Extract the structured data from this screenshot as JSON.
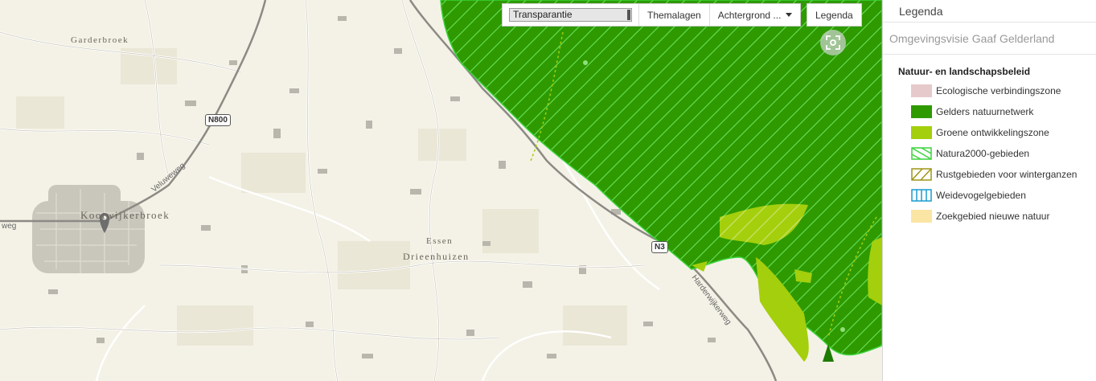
{
  "toolbar": {
    "transparency_label": "Transparantie",
    "themalagen_label": "Themalagen",
    "achtergrond_label": "Achtergrond ...",
    "legenda_label": "Legenda"
  },
  "map": {
    "places": {
      "garderbroek": "Garderbroek",
      "kootwijkerbroek": "Kootwijkerbroek",
      "essen": "Essen",
      "drieenhuizen": "Drieenhuizen"
    },
    "roads": {
      "n800": "N800",
      "n3": "N3",
      "veluweweg": "Veluweweg",
      "harderwijkerweg": "Harderwijkerweg",
      "weg": "weg"
    }
  },
  "panel": {
    "title": "Legenda",
    "subtitle": "Omgevingsvisie Gaaf Gelderland",
    "group_title": "Natuur- en landschapsbeleid",
    "items": [
      {
        "label": "Ecologische verbindingszone",
        "icon": "solid-swatch",
        "color": "#e6c9cb"
      },
      {
        "label": "Gelders natuurnetwerk",
        "icon": "solid-swatch",
        "color": "#2e9a00"
      },
      {
        "label": "Groene ontwikkelingszone",
        "icon": "solid-swatch",
        "color": "#a4cf0c"
      },
      {
        "label": "Natura2000-gebieden",
        "icon": "hatched-swatch",
        "color": "#3bd43b"
      },
      {
        "label": "Rustgebieden voor winterganzen",
        "icon": "hatched-swatch",
        "color": "#9e9616"
      },
      {
        "label": "Weidevogelgebieden",
        "icon": "vertical-stripe-swatch",
        "color": "#1a9bd0"
      },
      {
        "label": "Zoekgebied nieuwe natuur",
        "icon": "solid-swatch",
        "color": "#fae5a4"
      }
    ]
  }
}
